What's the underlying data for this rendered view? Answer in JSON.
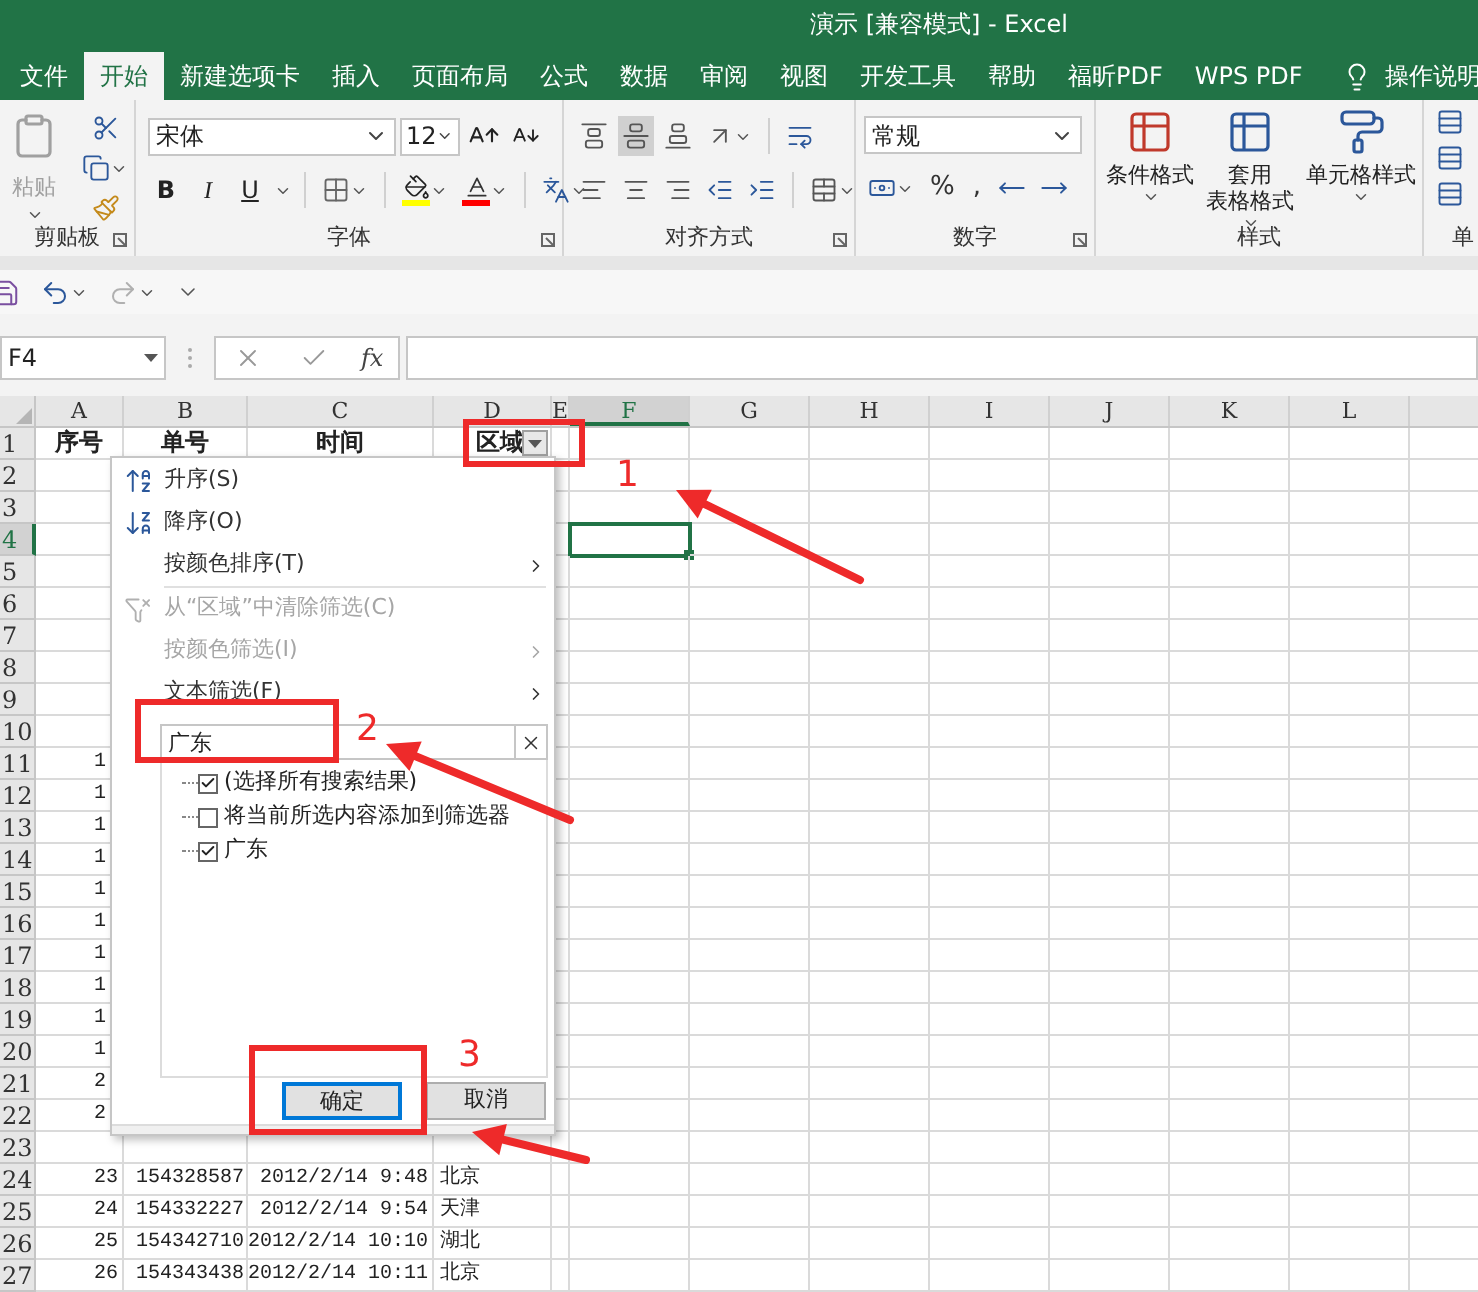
{
  "window": {
    "title": "演示 [兼容模式] - Excel"
  },
  "tabs": [
    {
      "label": "文件",
      "selected": false
    },
    {
      "label": "开始",
      "selected": true
    },
    {
      "label": "新建选项卡",
      "selected": false
    },
    {
      "label": "插入",
      "selected": false
    },
    {
      "label": "页面布局",
      "selected": false
    },
    {
      "label": "公式",
      "selected": false
    },
    {
      "label": "数据",
      "selected": false
    },
    {
      "label": "审阅",
      "selected": false
    },
    {
      "label": "视图",
      "selected": false
    },
    {
      "label": "开发工具",
      "selected": false
    },
    {
      "label": "帮助",
      "selected": false
    },
    {
      "label": "福昕PDF",
      "selected": false
    },
    {
      "label": "WPS PDF",
      "selected": false
    }
  ],
  "tell_me": "操作说明",
  "ribbon": {
    "clipboard": {
      "label": "剪贴板",
      "paste": {
        "label": "粘贴",
        "disabled": true
      }
    },
    "font": {
      "label": "字体",
      "name": "宋体",
      "size": "12",
      "styles": [
        "B",
        "I",
        "U"
      ]
    },
    "alignment": {
      "label": "对齐方式"
    },
    "number": {
      "label": "数字",
      "format": "常规",
      "symbols": [
        "%",
        ","
      ]
    },
    "styles": {
      "label": "样式",
      "buttons": [
        {
          "lines": [
            "条件格式"
          ]
        },
        {
          "lines": [
            "套用",
            "表格格式"
          ]
        },
        {
          "lines": [
            "单元格样式"
          ]
        }
      ]
    },
    "cells": {
      "label": "单"
    }
  },
  "formula_bar": {
    "name_box": "F4",
    "function_label": "fx"
  },
  "sheet": {
    "columns": [
      {
        "label": "A",
        "selected": false
      },
      {
        "label": "B",
        "selected": false
      },
      {
        "label": "C",
        "selected": false
      },
      {
        "label": "D",
        "selected": false
      },
      {
        "label": "E",
        "selected": false
      },
      {
        "label": "F",
        "selected": true
      },
      {
        "label": "G",
        "selected": false
      },
      {
        "label": "H",
        "selected": false
      },
      {
        "label": "I",
        "selected": false
      },
      {
        "label": "J",
        "selected": false
      },
      {
        "label": "K",
        "selected": false
      },
      {
        "label": "L",
        "selected": false
      }
    ],
    "rows": [
      {
        "label": "1",
        "selected": false,
        "kind": "header",
        "cells": [
          "序号",
          "单号",
          "时间",
          "区域"
        ]
      },
      {
        "label": "2",
        "selected": false,
        "kind": "data"
      },
      {
        "label": "3",
        "selected": false,
        "kind": "data"
      },
      {
        "label": "4",
        "selected": true,
        "kind": "data"
      },
      {
        "label": "5",
        "selected": false,
        "kind": "data"
      },
      {
        "label": "6",
        "selected": false,
        "kind": "data"
      },
      {
        "label": "7",
        "selected": false,
        "kind": "data"
      },
      {
        "label": "8",
        "selected": false,
        "kind": "data"
      },
      {
        "label": "9",
        "selected": false,
        "kind": "data"
      },
      {
        "label": "10",
        "selected": false,
        "kind": "data"
      },
      {
        "label": "11",
        "selected": false,
        "kind": "data",
        "cells": [
          "1"
        ]
      },
      {
        "label": "12",
        "selected": false,
        "kind": "data",
        "cells": [
          "1"
        ]
      },
      {
        "label": "13",
        "selected": false,
        "kind": "data",
        "cells": [
          "1"
        ]
      },
      {
        "label": "14",
        "selected": false,
        "kind": "data",
        "cells": [
          "1"
        ]
      },
      {
        "label": "15",
        "selected": false,
        "kind": "data",
        "cells": [
          "1"
        ]
      },
      {
        "label": "16",
        "selected": false,
        "kind": "data",
        "cells": [
          "1"
        ]
      },
      {
        "label": "17",
        "selected": false,
        "kind": "data",
        "cells": [
          "1"
        ]
      },
      {
        "label": "18",
        "selected": false,
        "kind": "data",
        "cells": [
          "1"
        ]
      },
      {
        "label": "19",
        "selected": false,
        "kind": "data",
        "cells": [
          "1"
        ]
      },
      {
        "label": "20",
        "selected": false,
        "kind": "data",
        "cells": [
          "1"
        ]
      },
      {
        "label": "21",
        "selected": false,
        "kind": "data",
        "cells": [
          "2"
        ]
      },
      {
        "label": "22",
        "selected": false,
        "kind": "data",
        "cells": [
          "2"
        ]
      },
      {
        "label": "23",
        "selected": false,
        "kind": "data"
      },
      {
        "label": "24",
        "selected": false,
        "kind": "data",
        "cells": [
          "23",
          "154328587",
          "2012/2/14 9:48",
          "北京"
        ]
      },
      {
        "label": "25",
        "selected": false,
        "kind": "data",
        "cells": [
          "24",
          "154332227",
          "2012/2/14 9:54",
          "天津"
        ]
      },
      {
        "label": "26",
        "selected": false,
        "kind": "data",
        "cells": [
          "25",
          "154342710",
          "2012/2/14 10:10",
          "湖北"
        ]
      },
      {
        "label": "27",
        "selected": false,
        "kind": "data",
        "cells": [
          "26",
          "154343438",
          "2012/2/14 10:11",
          "北京"
        ]
      }
    ]
  },
  "filter_menu": {
    "items": [
      {
        "kind": "sort_ascending",
        "label": "升序(S)",
        "disabled": false,
        "submenu": false
      },
      {
        "kind": "sort_descending",
        "label": "降序(O)",
        "disabled": false,
        "submenu": false
      },
      {
        "kind": "plain",
        "label": "按颜色排序(T)",
        "disabled": false,
        "submenu": true
      },
      {
        "kind": "separator"
      },
      {
        "kind": "clear_filter",
        "label": "从“区域”中清除筛选(C)",
        "disabled": true,
        "submenu": false
      },
      {
        "kind": "plain",
        "label": "按颜色筛选(I)",
        "disabled": true,
        "submenu": true
      },
      {
        "kind": "plain",
        "label": "文本筛选(F)",
        "disabled": false,
        "submenu": true
      }
    ],
    "search": {
      "value": "广东"
    },
    "options": [
      {
        "label": "(选择所有搜索结果)",
        "checked": true
      },
      {
        "label": "将当前所选内容添加到筛选器",
        "checked": false
      },
      {
        "label": "广东",
        "checked": true
      }
    ],
    "buttons": [
      {
        "label": "确定",
        "focused": true
      },
      {
        "label": "取消",
        "focused": false
      }
    ]
  },
  "annotations": [
    {
      "label": "1"
    },
    {
      "label": "2"
    },
    {
      "label": "3"
    }
  ]
}
